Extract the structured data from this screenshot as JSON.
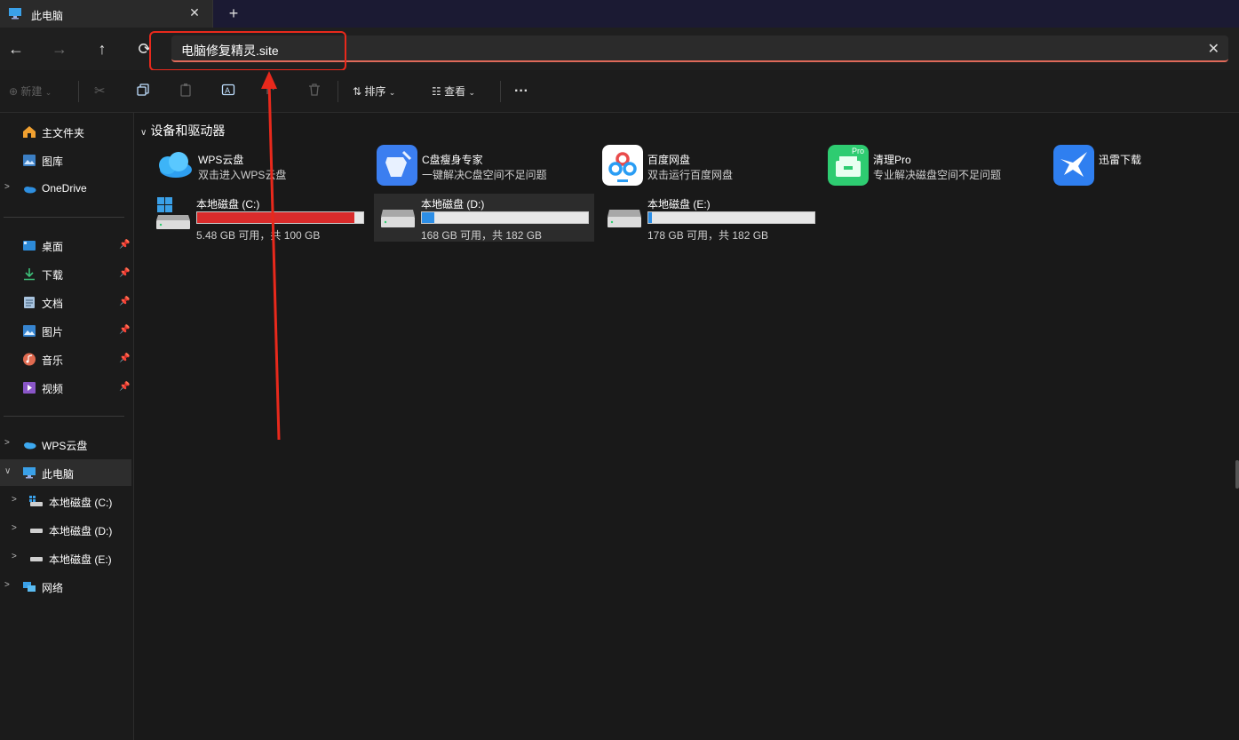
{
  "tab": {
    "title": "此电脑",
    "close": "✕",
    "new_tab": "+"
  },
  "nav": {
    "back": "←",
    "forward": "→",
    "up": "↑",
    "refresh": "⟳",
    "address": "电脑修复精灵.site",
    "clear": "✕"
  },
  "toolbar": {
    "new_label": "新建",
    "sort_label": "排序",
    "view_label": "查看",
    "more": "···"
  },
  "sidebar": {
    "quick": [
      {
        "label": "主文件夹",
        "icon": "home-icon"
      },
      {
        "label": "图库",
        "icon": "gallery-icon"
      },
      {
        "label": "OneDrive",
        "icon": "onedrive-icon"
      }
    ],
    "pinned": [
      {
        "label": "桌面",
        "icon": "desktop-icon"
      },
      {
        "label": "下载",
        "icon": "download-icon"
      },
      {
        "label": "文档",
        "icon": "documents-icon"
      },
      {
        "label": "图片",
        "icon": "pictures-icon"
      },
      {
        "label": "音乐",
        "icon": "music-icon"
      },
      {
        "label": "视频",
        "icon": "videos-icon"
      }
    ],
    "tree": [
      {
        "label": "WPS云盘",
        "icon": "wps-cloud-icon"
      },
      {
        "label": "此电脑",
        "icon": "this-pc-icon"
      },
      {
        "label": "本地磁盘 (C:)",
        "icon": "drive-c-icon"
      },
      {
        "label": "本地磁盘 (D:)",
        "icon": "drive-icon"
      },
      {
        "label": "本地磁盘 (E:)",
        "icon": "drive-icon"
      },
      {
        "label": "网络",
        "icon": "network-icon"
      }
    ]
  },
  "main": {
    "section_title": "设备和驱动器",
    "apps": [
      {
        "name": "WPS云盘",
        "desc": "双击进入WPS云盘",
        "icon": "wps-cloud-icon"
      },
      {
        "name": "C盘瘦身专家",
        "desc": "一键解决C盘空间不足问题",
        "icon": "broom-icon"
      },
      {
        "name": "百度网盘",
        "desc": "双击运行百度网盘",
        "icon": "baidu-netdisk-icon"
      },
      {
        "name": "清理Pro",
        "desc": "专业解决磁盘空间不足问题",
        "icon": "cleaner-pro-icon",
        "badge": "Pro"
      },
      {
        "name": "迅雷下载",
        "desc": "",
        "icon": "thunder-icon"
      }
    ],
    "drives": [
      {
        "name": "本地磁盘 (C:)",
        "info": "5.48 GB 可用，共 100 GB",
        "used_fraction": 0.945,
        "color": "#d92b2b"
      },
      {
        "name": "本地磁盘 (D:)",
        "info": "168 GB 可用，共 182 GB",
        "used_fraction": 0.077,
        "color": "#2c8ee6"
      },
      {
        "name": "本地磁盘 (E:)",
        "info": "178 GB 可用，共 182 GB",
        "used_fraction": 0.022,
        "color": "#2c8ee6"
      }
    ]
  }
}
